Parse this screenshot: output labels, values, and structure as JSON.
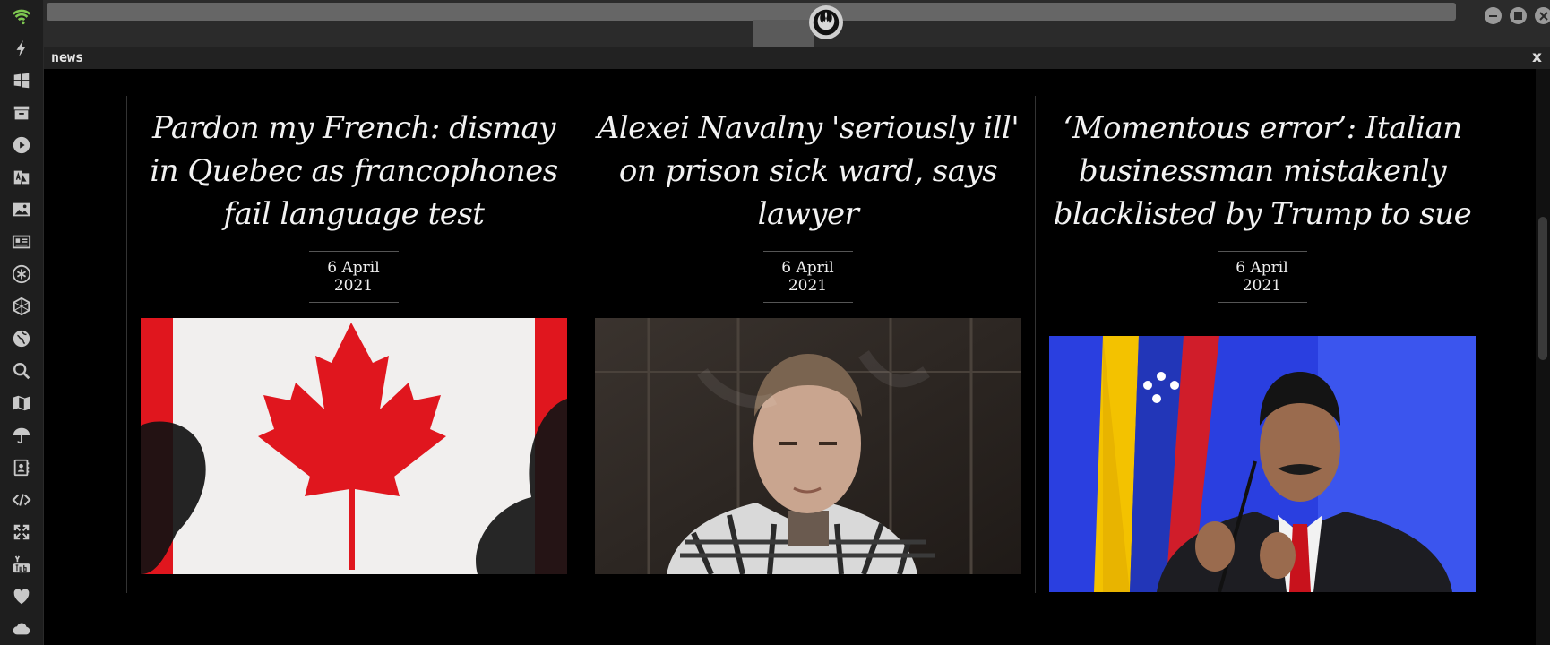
{
  "window": {
    "tab_label": "news",
    "close_label": "x"
  },
  "dock": {
    "items": [
      {
        "icon": "wifi-icon"
      },
      {
        "icon": "lightning-icon"
      },
      {
        "icon": "windows-icon"
      },
      {
        "icon": "archive-icon"
      },
      {
        "icon": "play-icon"
      },
      {
        "icon": "translate-icon"
      },
      {
        "icon": "image-icon"
      },
      {
        "icon": "newspaper-icon"
      },
      {
        "icon": "asterisk-icon"
      },
      {
        "icon": "hexagon-icon"
      },
      {
        "icon": "globe-icon"
      },
      {
        "icon": "search-icon"
      },
      {
        "icon": "map-icon"
      },
      {
        "icon": "umbrella-icon"
      },
      {
        "icon": "contacts-icon"
      },
      {
        "icon": "code-icon"
      },
      {
        "icon": "expand-icon"
      },
      {
        "icon": "youtube-icon"
      },
      {
        "icon": "heart-icon"
      },
      {
        "icon": "cloud-icon"
      }
    ]
  },
  "articles": [
    {
      "title": "Pardon my French: dismay in Quebec as francophones fail language test",
      "date": "6 April 2021",
      "image": "canadian-flag-photo"
    },
    {
      "title": "Alexei Navalny 'seriously ill' on prison sick ward, says lawyer",
      "date": "6 April 2021",
      "image": "navalny-photo"
    },
    {
      "title": "‘Momentous error’: Italian businessman mistakenly blacklisted by Trump to sue",
      "date": "6 April 2021",
      "image": "maduro-photo"
    }
  ],
  "colors": {
    "dock_bg": "#1e1e1e",
    "titlebar_bg": "#2b2b2b",
    "content_bg": "#000000",
    "wifi": "#7ec850",
    "flag_red": "#e0161e"
  }
}
